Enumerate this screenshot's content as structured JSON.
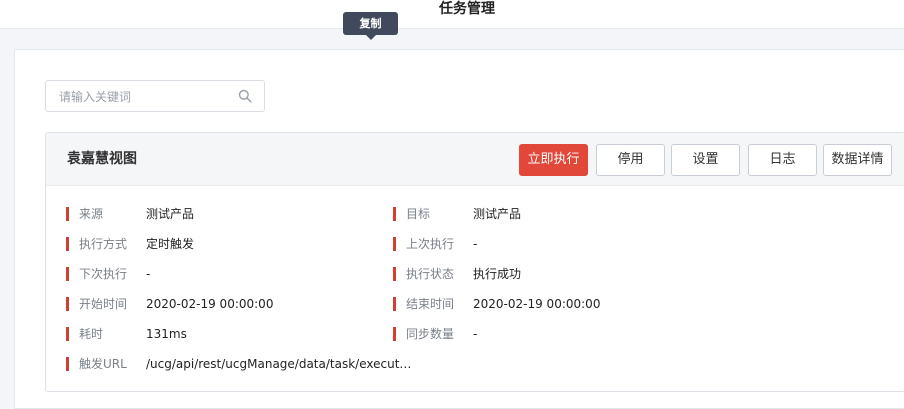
{
  "header": {
    "title": "任务管理"
  },
  "tooltip": {
    "text": "复制"
  },
  "search": {
    "placeholder": "请输入关键词",
    "value": ""
  },
  "task": {
    "name": "袁嘉慧视图",
    "actions": {
      "run_now": "立即执行",
      "disable": "停用",
      "settings": "设置",
      "log": "日志",
      "data_details": "数据详情"
    },
    "fields": {
      "source": {
        "label": "来源",
        "value": "测试产品"
      },
      "target": {
        "label": "目标",
        "value": "测试产品"
      },
      "exec_mode": {
        "label": "执行方式",
        "value": "定时触发"
      },
      "last_exec": {
        "label": "上次执行",
        "value": "-"
      },
      "next_exec": {
        "label": "下次执行",
        "value": "-"
      },
      "exec_status": {
        "label": "执行状态",
        "value": "执行成功"
      },
      "start_time": {
        "label": "开始时间",
        "value": "2020-02-19 00:00:00"
      },
      "end_time": {
        "label": "结束时间",
        "value": "2020-02-19 00:00:00"
      },
      "duration": {
        "label": "耗时",
        "value": "131ms"
      },
      "sync_count": {
        "label": "同步数量",
        "value": "-"
      },
      "trigger_url": {
        "label": "触发URL",
        "value": "/ucg/api/rest/ucgManage/data/task/execut…"
      }
    }
  },
  "colors": {
    "accent": "#e2483a",
    "bar": "#cf3f34",
    "tooltip_bg": "#404a5c"
  }
}
